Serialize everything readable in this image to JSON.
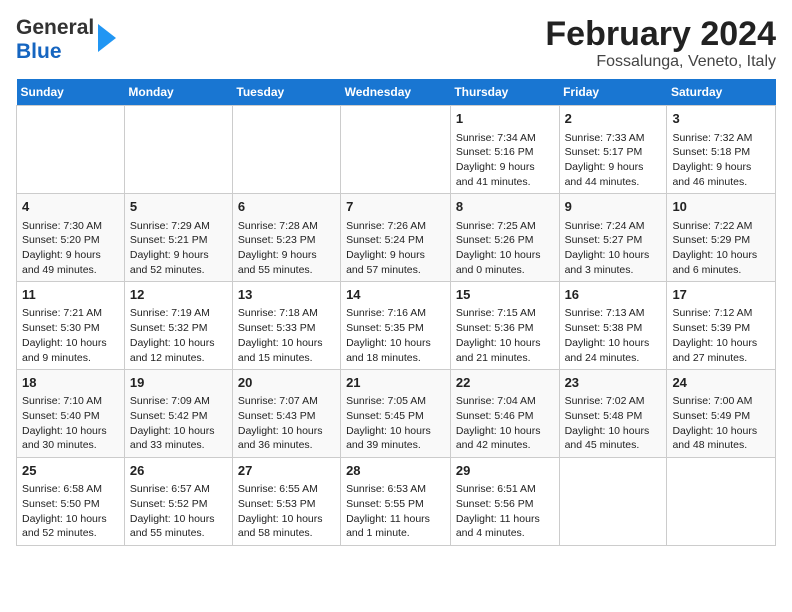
{
  "header": {
    "title": "February 2024",
    "subtitle": "Fossalunga, Veneto, Italy",
    "logo_top": "General",
    "logo_bot": "Blue"
  },
  "days_of_week": [
    "Sunday",
    "Monday",
    "Tuesday",
    "Wednesday",
    "Thursday",
    "Friday",
    "Saturday"
  ],
  "weeks": [
    [
      {
        "day": "",
        "info": ""
      },
      {
        "day": "",
        "info": ""
      },
      {
        "day": "",
        "info": ""
      },
      {
        "day": "",
        "info": ""
      },
      {
        "day": "1",
        "info": "Sunrise: 7:34 AM\nSunset: 5:16 PM\nDaylight: 9 hours\nand 41 minutes."
      },
      {
        "day": "2",
        "info": "Sunrise: 7:33 AM\nSunset: 5:17 PM\nDaylight: 9 hours\nand 44 minutes."
      },
      {
        "day": "3",
        "info": "Sunrise: 7:32 AM\nSunset: 5:18 PM\nDaylight: 9 hours\nand 46 minutes."
      }
    ],
    [
      {
        "day": "4",
        "info": "Sunrise: 7:30 AM\nSunset: 5:20 PM\nDaylight: 9 hours\nand 49 minutes."
      },
      {
        "day": "5",
        "info": "Sunrise: 7:29 AM\nSunset: 5:21 PM\nDaylight: 9 hours\nand 52 minutes."
      },
      {
        "day": "6",
        "info": "Sunrise: 7:28 AM\nSunset: 5:23 PM\nDaylight: 9 hours\nand 55 minutes."
      },
      {
        "day": "7",
        "info": "Sunrise: 7:26 AM\nSunset: 5:24 PM\nDaylight: 9 hours\nand 57 minutes."
      },
      {
        "day": "8",
        "info": "Sunrise: 7:25 AM\nSunset: 5:26 PM\nDaylight: 10 hours\nand 0 minutes."
      },
      {
        "day": "9",
        "info": "Sunrise: 7:24 AM\nSunset: 5:27 PM\nDaylight: 10 hours\nand 3 minutes."
      },
      {
        "day": "10",
        "info": "Sunrise: 7:22 AM\nSunset: 5:29 PM\nDaylight: 10 hours\nand 6 minutes."
      }
    ],
    [
      {
        "day": "11",
        "info": "Sunrise: 7:21 AM\nSunset: 5:30 PM\nDaylight: 10 hours\nand 9 minutes."
      },
      {
        "day": "12",
        "info": "Sunrise: 7:19 AM\nSunset: 5:32 PM\nDaylight: 10 hours\nand 12 minutes."
      },
      {
        "day": "13",
        "info": "Sunrise: 7:18 AM\nSunset: 5:33 PM\nDaylight: 10 hours\nand 15 minutes."
      },
      {
        "day": "14",
        "info": "Sunrise: 7:16 AM\nSunset: 5:35 PM\nDaylight: 10 hours\nand 18 minutes."
      },
      {
        "day": "15",
        "info": "Sunrise: 7:15 AM\nSunset: 5:36 PM\nDaylight: 10 hours\nand 21 minutes."
      },
      {
        "day": "16",
        "info": "Sunrise: 7:13 AM\nSunset: 5:38 PM\nDaylight: 10 hours\nand 24 minutes."
      },
      {
        "day": "17",
        "info": "Sunrise: 7:12 AM\nSunset: 5:39 PM\nDaylight: 10 hours\nand 27 minutes."
      }
    ],
    [
      {
        "day": "18",
        "info": "Sunrise: 7:10 AM\nSunset: 5:40 PM\nDaylight: 10 hours\nand 30 minutes."
      },
      {
        "day": "19",
        "info": "Sunrise: 7:09 AM\nSunset: 5:42 PM\nDaylight: 10 hours\nand 33 minutes."
      },
      {
        "day": "20",
        "info": "Sunrise: 7:07 AM\nSunset: 5:43 PM\nDaylight: 10 hours\nand 36 minutes."
      },
      {
        "day": "21",
        "info": "Sunrise: 7:05 AM\nSunset: 5:45 PM\nDaylight: 10 hours\nand 39 minutes."
      },
      {
        "day": "22",
        "info": "Sunrise: 7:04 AM\nSunset: 5:46 PM\nDaylight: 10 hours\nand 42 minutes."
      },
      {
        "day": "23",
        "info": "Sunrise: 7:02 AM\nSunset: 5:48 PM\nDaylight: 10 hours\nand 45 minutes."
      },
      {
        "day": "24",
        "info": "Sunrise: 7:00 AM\nSunset: 5:49 PM\nDaylight: 10 hours\nand 48 minutes."
      }
    ],
    [
      {
        "day": "25",
        "info": "Sunrise: 6:58 AM\nSunset: 5:50 PM\nDaylight: 10 hours\nand 52 minutes."
      },
      {
        "day": "26",
        "info": "Sunrise: 6:57 AM\nSunset: 5:52 PM\nDaylight: 10 hours\nand 55 minutes."
      },
      {
        "day": "27",
        "info": "Sunrise: 6:55 AM\nSunset: 5:53 PM\nDaylight: 10 hours\nand 58 minutes."
      },
      {
        "day": "28",
        "info": "Sunrise: 6:53 AM\nSunset: 5:55 PM\nDaylight: 11 hours\nand 1 minute."
      },
      {
        "day": "29",
        "info": "Sunrise: 6:51 AM\nSunset: 5:56 PM\nDaylight: 11 hours\nand 4 minutes."
      },
      {
        "day": "",
        "info": ""
      },
      {
        "day": "",
        "info": ""
      }
    ]
  ]
}
